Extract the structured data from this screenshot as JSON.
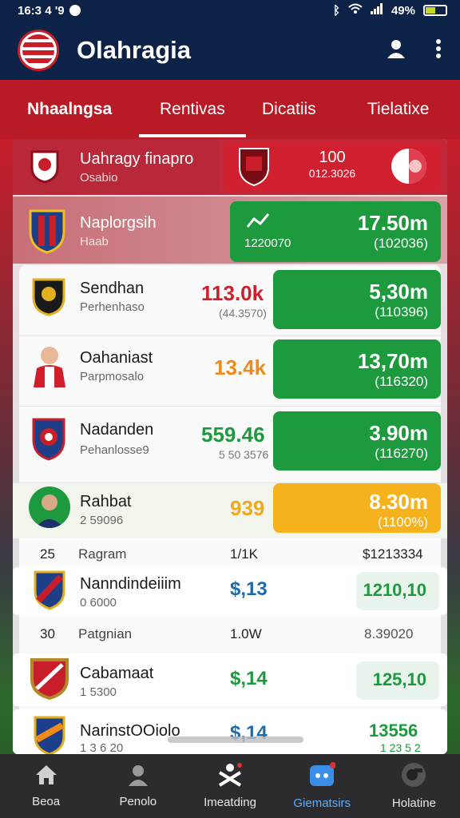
{
  "status_bar": {
    "time": "16:3 4 '9",
    "battery": "49%"
  },
  "app": {
    "title": "Olahragia"
  },
  "tabs": [
    {
      "label": "Nhaalngsa",
      "active": true
    },
    {
      "label": "Rentivas",
      "selected": true
    },
    {
      "label": "Dicatiis"
    },
    {
      "label": "Tielatixe"
    }
  ],
  "rows": [
    {
      "name": "Uahragy finapro",
      "sub": "Osabio",
      "pill_big": "100",
      "pill_small": "012.3026"
    },
    {
      "name": "Naplorgsih",
      "sub": "Haab",
      "pill_big": "17.50m",
      "pill_small": "(102036)",
      "pill_left": "1220070"
    },
    {
      "name": "Sendhan",
      "sub": "Perhenhaso",
      "mid": "113.0k",
      "mid_sub": "(44.3570)",
      "pill_big": "5,30m",
      "pill_small": "(110396)"
    },
    {
      "name": "Oahaniast",
      "sub": "Parpmosalo",
      "mid": "13.4k",
      "pill_big": "13,70m",
      "pill_small": "(116320)"
    },
    {
      "name": "Nadanden",
      "sub": "Pehanlosse9",
      "mid": "559.46",
      "mid_sub": "5 50 3576",
      "pill_big": "3.90m",
      "pill_small": "(116270)"
    },
    {
      "name": "Rahbat",
      "sub": "2 59096",
      "mid": "939",
      "pill_big": "8.30m",
      "pill_small": "(1100%)"
    }
  ],
  "separators": [
    {
      "rank": "25",
      "name": "Ragram",
      "value": "1/1K",
      "amount": "$1213334"
    },
    {
      "rank": "30",
      "name": "Patgnian",
      "value": "1.0W",
      "amount": "8.39020"
    }
  ],
  "lower_rows": [
    {
      "name": "Nanndindeiiim",
      "sub": "0 6000",
      "mid": "$,13",
      "value": "1210,10"
    },
    {
      "name": "Cabamaat",
      "sub": "1 5300",
      "mid": "$,14",
      "value": "125,10"
    },
    {
      "name": "NarinstOOiolo",
      "sub": "1 3 6 20",
      "mid": "$,14",
      "value": "13556",
      "value_sub": "1 23 5 2"
    }
  ],
  "bottom_nav": [
    {
      "label": "Beoa",
      "icon": "home-icon"
    },
    {
      "label": "Penolo",
      "icon": "person-icon"
    },
    {
      "label": "Imeatding",
      "icon": "player-icon"
    },
    {
      "label": "Giematsirs",
      "icon": "games-icon",
      "active": true
    },
    {
      "label": "Holatine",
      "icon": "whistle-icon"
    }
  ],
  "colors": {
    "navy": "#0c2247",
    "red": "#c81e2a",
    "green": "#1e9a3e",
    "orange": "#f0a820"
  }
}
